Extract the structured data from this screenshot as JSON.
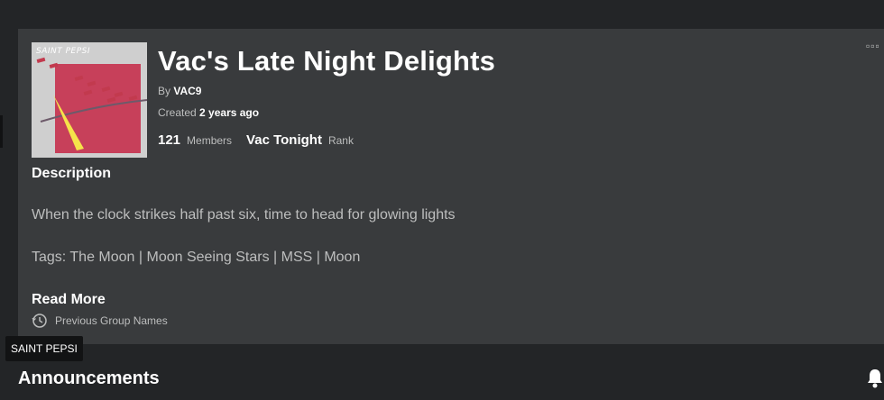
{
  "thumbnail": {
    "art_text": "SAINT PEPSI",
    "colors": {
      "background": "#cfcfcf",
      "panel": "#c7405a",
      "accent": "#f5e34a",
      "marks": "#c23a4e"
    }
  },
  "group": {
    "title": "Vac's Late Night Delights",
    "by_label": "By",
    "owner": "VAC9",
    "created_label": "Created",
    "created_value": "2 years ago",
    "member_count": "121",
    "members_label": "Members",
    "rank_value": "Vac Tonight",
    "rank_label": "Rank"
  },
  "menu": {
    "more_icon": "more-options-icon"
  },
  "description": {
    "heading": "Description",
    "text": "When the clock strikes half past six, time to head for glowing lights",
    "tags": "Tags: The Moon | Moon Seeing Stars | MSS | Moon",
    "read_more": "Read More",
    "previous_names": "Previous Group Names",
    "previous_names_icon": "history-icon"
  },
  "tooltip": {
    "text": "SAINT PEPSI"
  },
  "announcements": {
    "heading": "Announcements",
    "icon": "bell-icon"
  }
}
